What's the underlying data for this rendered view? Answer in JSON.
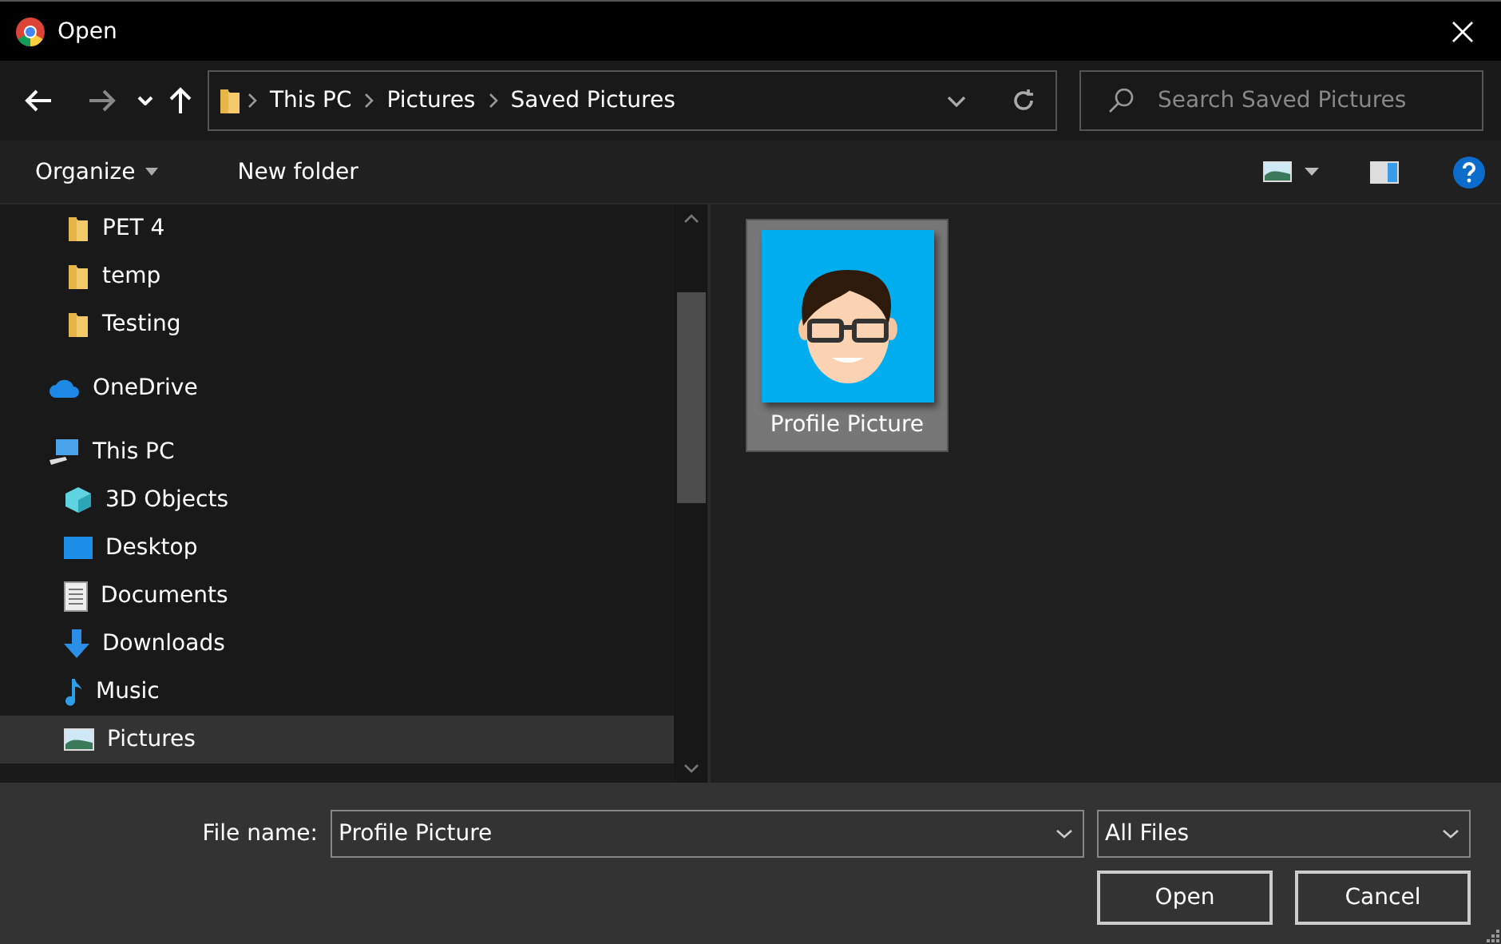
{
  "window": {
    "title": "Open"
  },
  "address_bar": {
    "crumbs": [
      "This PC",
      "Pictures",
      "Saved Pictures"
    ]
  },
  "search": {
    "placeholder": "Search Saved Pictures"
  },
  "toolbar": {
    "organize": "Organize",
    "new_folder": "New folder"
  },
  "sidebar": {
    "folders": [
      {
        "label": "PET 4",
        "selected": false
      },
      {
        "label": "temp",
        "selected": false
      },
      {
        "label": "Testing",
        "selected": false
      }
    ],
    "locations": [
      {
        "label": "OneDrive",
        "kind": "cloud",
        "selected": false
      },
      {
        "label": "This PC",
        "kind": "pc",
        "selected": false,
        "children": [
          {
            "label": "3D Objects",
            "kind": "cube",
            "selected": false
          },
          {
            "label": "Desktop",
            "kind": "desktop",
            "selected": false
          },
          {
            "label": "Documents",
            "kind": "document",
            "selected": false
          },
          {
            "label": "Downloads",
            "kind": "download",
            "selected": false
          },
          {
            "label": "Music",
            "kind": "music",
            "selected": false
          },
          {
            "label": "Pictures",
            "kind": "pictures",
            "selected": true
          }
        ]
      }
    ]
  },
  "files": [
    {
      "name": "Profile Picture",
      "selected": true
    }
  ],
  "footer": {
    "file_name_label": "File name:",
    "file_name": "Profile Picture",
    "file_type": "All Files",
    "open": "Open",
    "cancel": "Cancel"
  }
}
